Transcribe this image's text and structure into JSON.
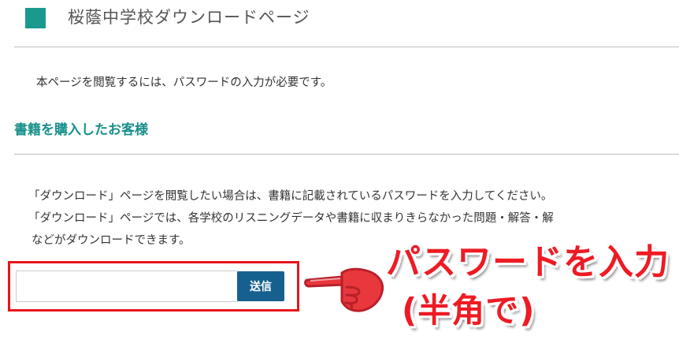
{
  "header": {
    "title": "桜蔭中学校ダウンロードページ",
    "accent_color": "#1a9a8f"
  },
  "intro_text": "本ページを閲覧するには、パスワードの入力が必要です。",
  "section": {
    "heading": "書籍を購入したお客様",
    "heading_color": "#17908a",
    "lines": [
      "「ダウンロード」ページを閲覧したい場合は、書籍に記載されているパスワードを入力してください。",
      "「ダウンロード」ページでは、各学校のリスニングデータや書籍に収まりきらなかった問題・解答・解",
      "などがダウンロードできます。"
    ]
  },
  "form": {
    "password_value": "",
    "password_placeholder": "",
    "submit_label": "送信",
    "submit_color": "#16608f",
    "highlight_color": "#e8141c"
  },
  "annotation": {
    "line1": "パスワードを入力",
    "line2": "(半角で)",
    "color": "#ee1b24",
    "icon": "pointing-hand-icon"
  }
}
